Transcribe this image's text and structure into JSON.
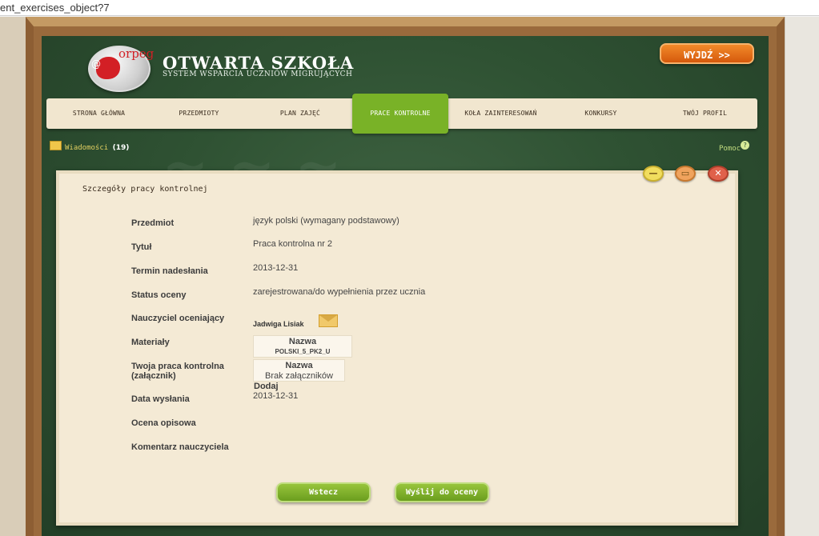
{
  "browser": {
    "url": "ent_exercises_object?7"
  },
  "brand": {
    "title": "OTWARTA SZKOŁA",
    "subtitle": "SYSTEM WSPARCIA UCZNIÓW MIGRUJĄCYCH",
    "logo_letters": "orpeg",
    "logo_at": "@"
  },
  "header": {
    "logout_label": "WYJDŹ >>"
  },
  "nav": {
    "items": [
      {
        "label": "STRONA GŁÓWNA"
      },
      {
        "label": "PRZEDMIOTY"
      },
      {
        "label": "PLAN ZAJĘĆ"
      },
      {
        "label": "PRACE KONTROLNE",
        "active": true
      },
      {
        "label": "KOŁA ZAINTERESOWAŃ"
      },
      {
        "label": "KONKURSY"
      },
      {
        "label": "TWÓJ PROFIL"
      }
    ]
  },
  "messages": {
    "label": "Wiadomości",
    "count": "(19)"
  },
  "help": {
    "label": "Pomoc",
    "bubble": "?"
  },
  "panel": {
    "title": "Szczegóły pracy kontrolnej",
    "fields": {
      "subject_label": "Przedmiot",
      "subject_value": "język polski (wymagany podstawowy)",
      "title_label": "Tytuł",
      "title_value": "Praca kontrolna nr 2",
      "deadline_label": "Termin nadesłania",
      "deadline_value": "2013-12-31",
      "status_label": "Status oceny",
      "status_value": "zarejestrowana/do wypełnienia przez ucznia",
      "teacher_label": "Nauczyciel oceniający",
      "teacher_value": "Jadwiga Lisiak",
      "materials_label": "Materiały",
      "materials_header": "Nazwa",
      "materials_file": "POLSKI_5_PK2_U",
      "attachment_label_1": "Twoja praca kontrolna",
      "attachment_label_2": "(załącznik)",
      "attachment_header": "Nazwa",
      "attachment_empty": "Brak załączników",
      "add_label": "Dodaj",
      "sent_label": "Data wysłania",
      "sent_value": "2013-12-31",
      "grade_label": "Ocena opisowa",
      "comment_label": "Komentarz nauczyciela"
    },
    "buttons": {
      "back": "Wstecz",
      "send": "Wyślij do oceny"
    },
    "window_controls": {
      "minimize": "—",
      "maximize": "▭",
      "close": "✕"
    }
  }
}
